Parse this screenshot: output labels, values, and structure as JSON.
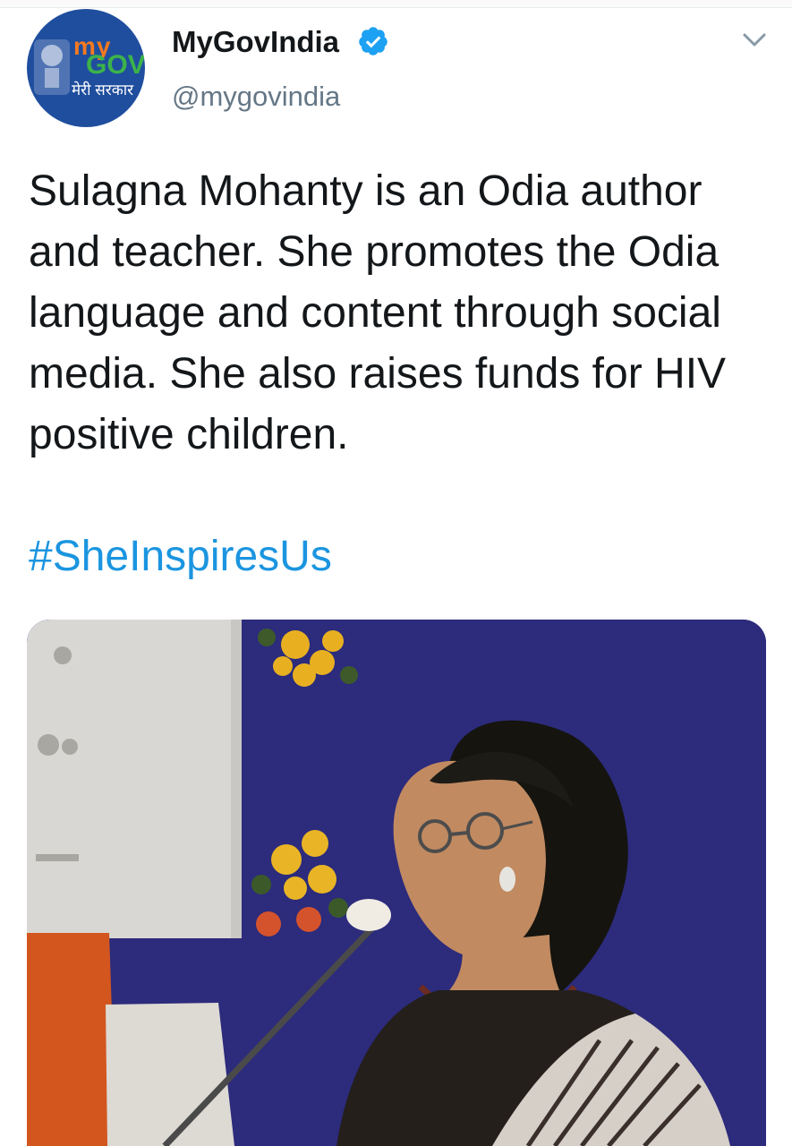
{
  "tweet": {
    "author": {
      "display_name": "MyGovIndia",
      "handle": "@mygovindia",
      "verified": true,
      "avatar": {
        "logo_top": "my",
        "logo_bottom": "GOV",
        "logo_tagline": "मेरी सरकार"
      }
    },
    "text": "Sulagna Mohanty is an Odia author and teacher. She promotes the Odia language and content through social media. She also raises funds for HIV positive children.",
    "hashtag": "#SheInspiresUs",
    "media": {
      "type": "photo"
    }
  },
  "icons": {
    "verified": "verified-badge-icon",
    "menu": "chevron-down-icon"
  },
  "colors": {
    "link": "#1b95e0",
    "verified": "#1da1f2",
    "secondary_text": "#657786",
    "avatar_bg": "#1f4e9e"
  }
}
